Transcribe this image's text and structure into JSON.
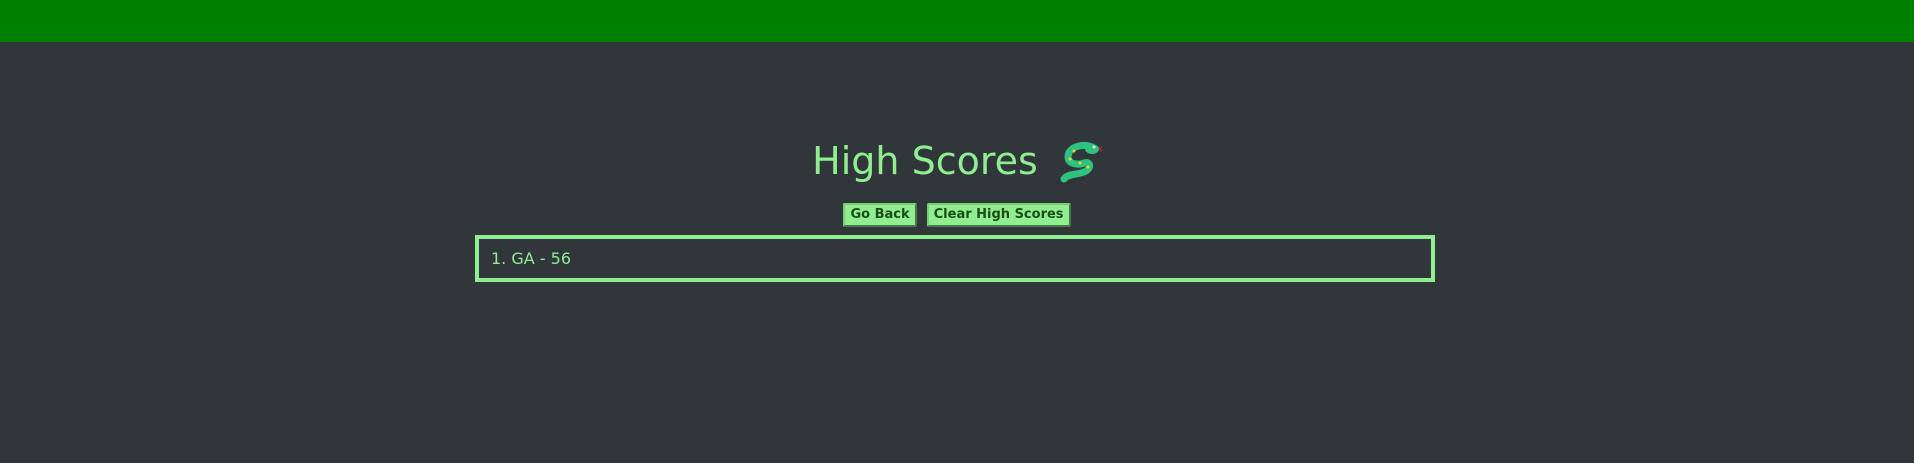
{
  "header": {
    "bar_color": "#008000"
  },
  "page": {
    "title": "High Scores",
    "title_icon": "snake-icon",
    "accent_color": "#90ee90",
    "background_color": "#31363b"
  },
  "buttons": {
    "go_back_label": "Go Back",
    "clear_label": "Clear High Scores"
  },
  "scores": [
    {
      "text": "1. GA - 56"
    }
  ]
}
